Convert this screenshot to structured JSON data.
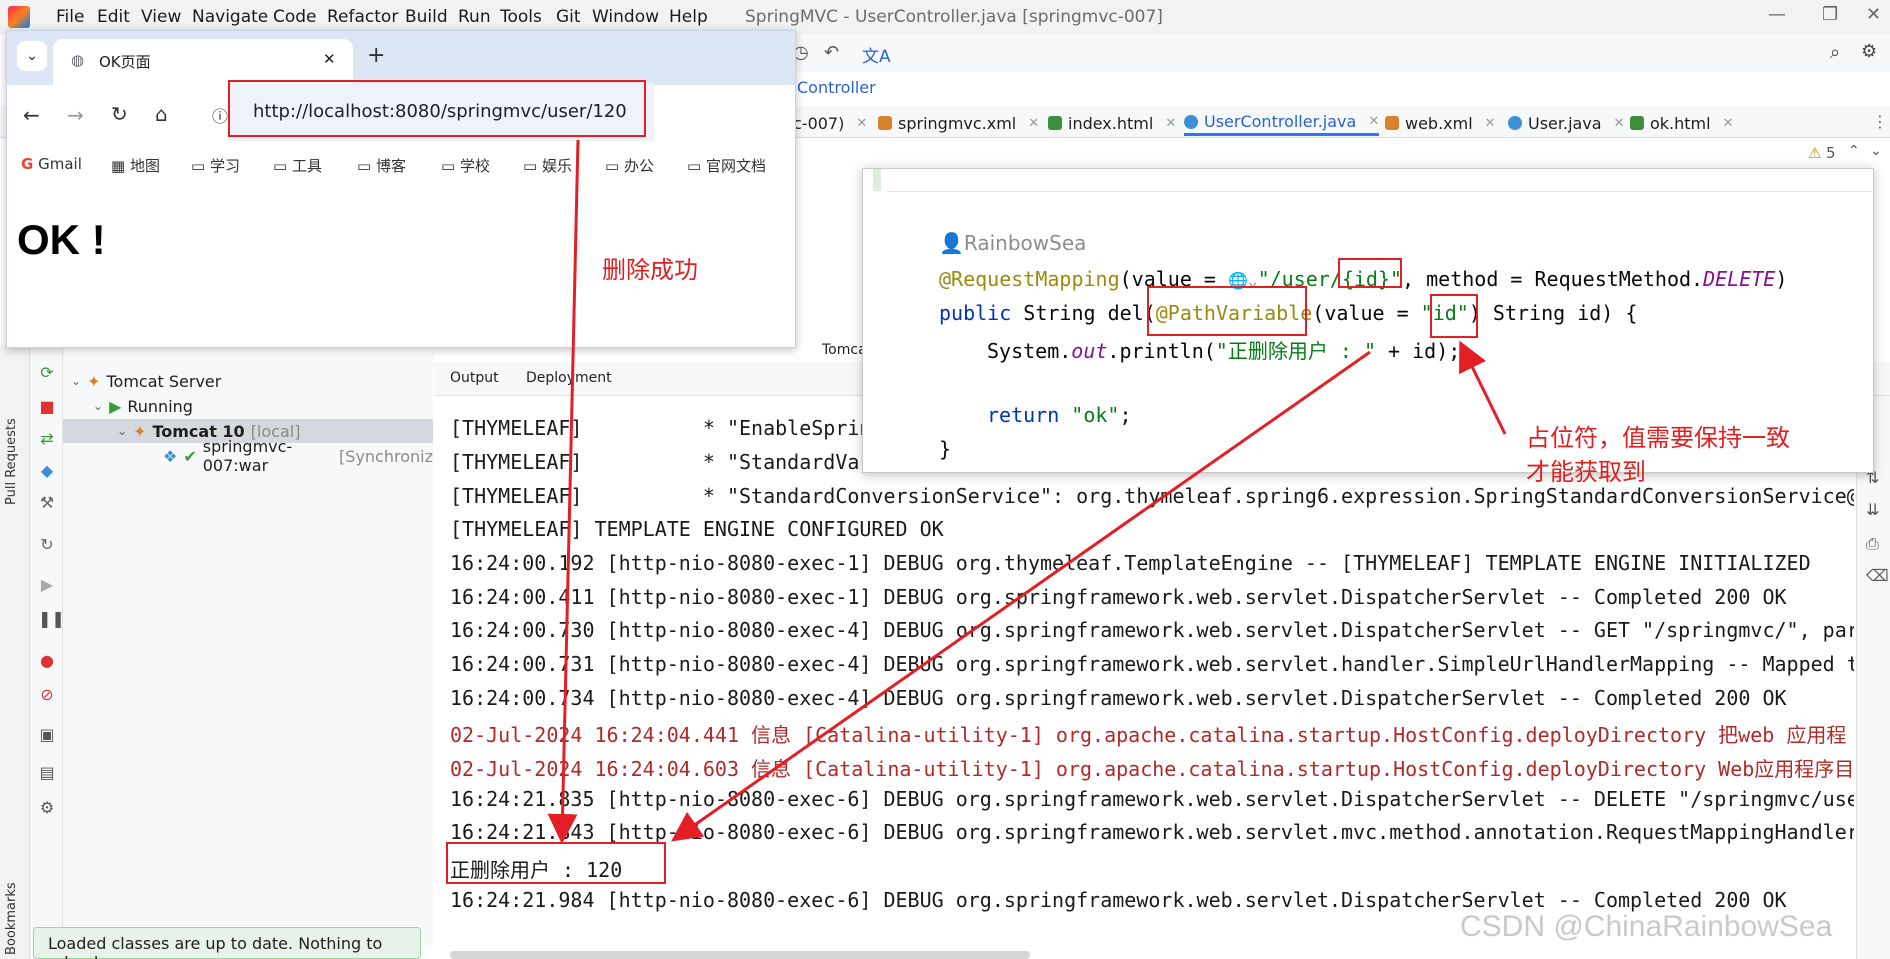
{
  "ide": {
    "menu": [
      "File",
      "Edit",
      "View",
      "Navigate",
      "Code",
      "Refactor",
      "Build",
      "Run",
      "Tools",
      "Git",
      "Window",
      "Help"
    ],
    "title": "SpringMVC - UserController.java [springmvc-007]",
    "breadcrumb_fragment": "Controller",
    "tabs": [
      {
        "label": "c-007)",
        "icon_color": "#6c8fd6"
      },
      {
        "label": "springmvc.xml",
        "icon_color": "#d9822b"
      },
      {
        "label": "index.html",
        "icon_color": "#3d8f3d"
      },
      {
        "label": "UserController.java",
        "icon_color": "#3d8fd6",
        "active": true
      },
      {
        "label": "web.xml",
        "icon_color": "#d9822b"
      },
      {
        "label": "User.java",
        "icon_color": "#3d8fd6"
      },
      {
        "label": "ok.html",
        "icon_color": "#3d8f3d"
      }
    ],
    "warnings_count": "5"
  },
  "browser": {
    "tab_title": "OK页面",
    "address": "http://localhost:8080/springmvc/user/120",
    "bookmarks": [
      "Gmail",
      "地图",
      "学习",
      "工具",
      "博客",
      "学校",
      "娱乐",
      "办公",
      "官网文档"
    ],
    "page_heading": "OK !"
  },
  "services": {
    "tree": [
      {
        "label": "Tomcat Server",
        "suffix": ""
      },
      {
        "label": "Running",
        "suffix": ""
      },
      {
        "label": "Tomcat 10",
        "suffix": "[local]"
      },
      {
        "label": "springmvc-007:war",
        "suffix": "[Synchroniz"
      }
    ],
    "side_labels": [
      "Pull Requests",
      "Bookmarks"
    ],
    "status_message": "Loaded classes are up to date. Nothing to reload."
  },
  "console": {
    "tabs": [
      "Output",
      "Deployment"
    ],
    "tomcat_label": "Tomcat",
    "lines": [
      {
        "text": "[THYMELEAF]          * \"EnableSpring",
        "red": false
      },
      {
        "text": "[THYMELEAF]          * \"StandardVari",
        "red": false
      },
      {
        "text": "[THYMELEAF]          * \"StandardConversionService\": org.thymeleaf.spring6.expression.SpringStandardConversionService@9",
        "red": false
      },
      {
        "text": "[THYMELEAF] TEMPLATE ENGINE CONFIGURED OK",
        "red": false
      },
      {
        "text": "16:24:00.192 [http-nio-8080-exec-1] DEBUG org.thymeleaf.TemplateEngine -- [THYMELEAF] TEMPLATE ENGINE INITIALIZED",
        "red": false
      },
      {
        "text": "16:24:00.411 [http-nio-8080-exec-1] DEBUG org.springframework.web.servlet.DispatcherServlet -- Completed 200 OK",
        "red": false
      },
      {
        "text": "16:24:00.730 [http-nio-8080-exec-4] DEBUG org.springframework.web.servlet.DispatcherServlet -- GET \"/springmvc/\", para",
        "red": false
      },
      {
        "text": "16:24:00.731 [http-nio-8080-exec-4] DEBUG org.springframework.web.servlet.handler.SimpleUrlHandlerMapping -- Mapped to",
        "red": false
      },
      {
        "text": "16:24:00.734 [http-nio-8080-exec-4] DEBUG org.springframework.web.servlet.DispatcherServlet -- Completed 200 OK",
        "red": false
      },
      {
        "text": "02-Jul-2024 16:24:04.441 信息 [Catalina-utility-1] org.apache.catalina.startup.HostConfig.deployDirectory 把web 应用程",
        "red": true
      },
      {
        "text": "02-Jul-2024 16:24:04.603 信息 [Catalina-utility-1] org.apache.catalina.startup.HostConfig.deployDirectory Web应用程序目",
        "red": true
      },
      {
        "text": "16:24:21.835 [http-nio-8080-exec-6] DEBUG org.springframework.web.servlet.DispatcherServlet -- DELETE \"/springmvc/user",
        "red": false
      },
      {
        "text": "16:24:21.843 [http-nio-8080-exec-6] DEBUG org.springframework.web.servlet.mvc.method.annotation.RequestMappingHandlerM",
        "red": false
      },
      {
        "text": "正删除用户 : 120",
        "red": false
      },
      {
        "text": "16:24:21.984 [http-nio-8080-exec-6] DEBUG org.springframework.web.servlet.DispatcherServlet -- Completed 200 OK",
        "red": false
      }
    ]
  },
  "code": {
    "author": "RainbowSea",
    "line1": {
      "ann": "@RequestMapping",
      "p1": "(value = ",
      "str": "\"/user/{id}\"",
      "p2": ", method = RequestMethod.",
      "enum": "DELETE",
      "p3": ")"
    },
    "line2": {
      "kw": "public",
      "p1": " String del(",
      "ann": "@PathVariable",
      "p2": "(value = ",
      "str": "\"id\"",
      "p3": ") String id) {"
    },
    "line3": {
      "p1": "System.",
      "field": "out",
      "p2": ".println(",
      "str": "\"正删除用户 : \"",
      "p3": " + id);"
    },
    "line4": {
      "kw": "return",
      "sp": " ",
      "str": "\"ok\"",
      "p1": ";"
    },
    "line5": "}"
  },
  "annotations": {
    "delete_success": "删除成功",
    "placeholder_note_line1": "占位符，值需要保持一致",
    "placeholder_note_line2": "才能获取到",
    "color": "#e31e24"
  },
  "watermark": "CSDN @ChinaRainbowSea"
}
